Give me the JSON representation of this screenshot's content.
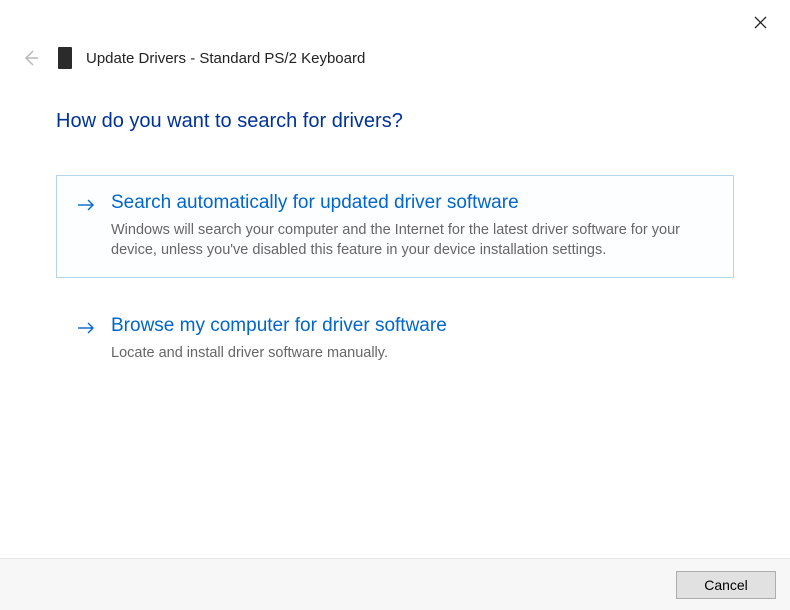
{
  "window": {
    "title": "Update Drivers - Standard PS/2 Keyboard"
  },
  "heading": "How do you want to search for drivers?",
  "options": [
    {
      "title": "Search automatically for updated driver software",
      "desc": "Windows will search your computer and the Internet for the latest driver software for your device, unless you've disabled this feature in your device installation settings."
    },
    {
      "title": "Browse my computer for driver software",
      "desc": "Locate and install driver software manually."
    }
  ],
  "buttons": {
    "cancel": "Cancel"
  }
}
